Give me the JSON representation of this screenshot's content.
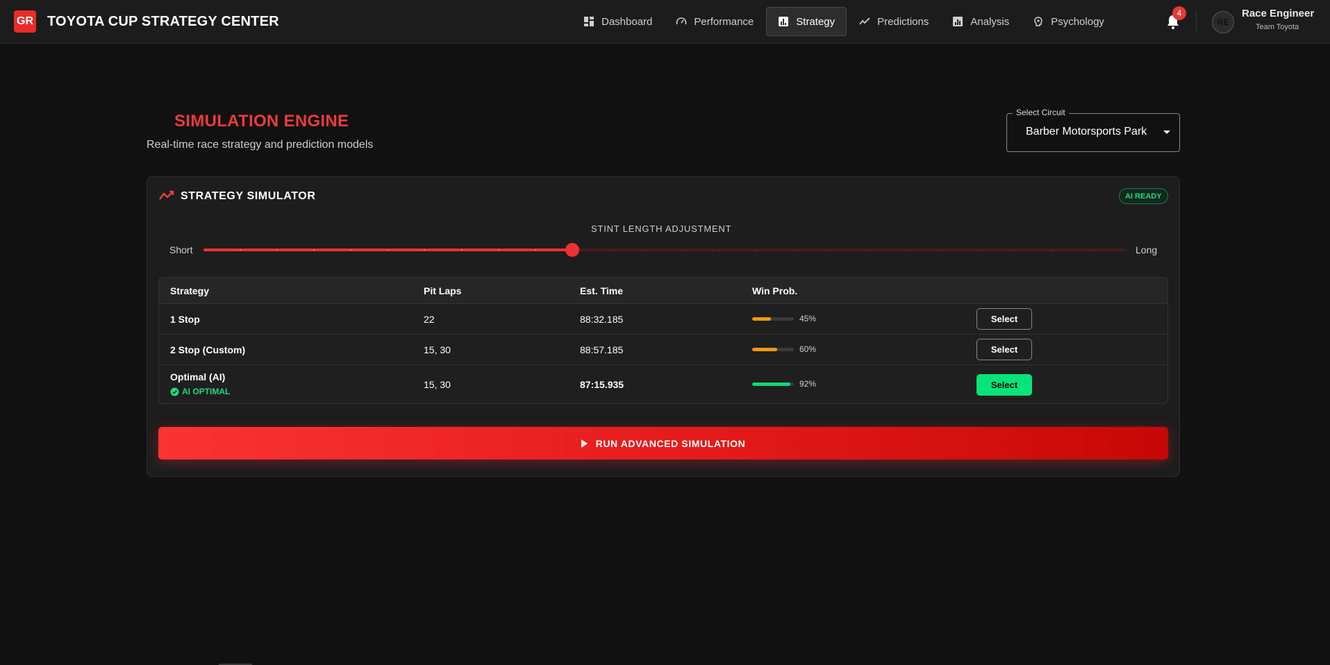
{
  "header": {
    "logo_text": "GR",
    "app_title": "TOYOTA CUP STRATEGY CENTER",
    "nav": [
      {
        "label": "Dashboard",
        "icon": "dashboard-icon",
        "active": false
      },
      {
        "label": "Performance",
        "icon": "speedometer-icon",
        "active": false
      },
      {
        "label": "Strategy",
        "icon": "bar-chart-icon",
        "active": true
      },
      {
        "label": "Predictions",
        "icon": "trend-line-icon",
        "active": false
      },
      {
        "label": "Analysis",
        "icon": "analytics-icon",
        "active": false
      },
      {
        "label": "Psychology",
        "icon": "brain-icon",
        "active": false
      }
    ],
    "notifications_count": "4",
    "user": {
      "initials": "RE",
      "name": "Race Engineer",
      "team": "Team Toyota"
    }
  },
  "page": {
    "title": "SIMULATION ENGINE",
    "subtitle": "Real-time race strategy and prediction models",
    "circuit_select": {
      "label": "Select Circuit",
      "value": "Barber Motorsports Park"
    }
  },
  "simulator": {
    "title": "STRATEGY SIMULATOR",
    "badge": "AI READY",
    "slider": {
      "label": "STINT LENGTH ADJUSTMENT",
      "min_label": "Short",
      "max_label": "Long",
      "steps": 25,
      "value_fraction": 0.4
    },
    "table": {
      "columns": [
        "Strategy",
        "Pit Laps",
        "Est. Time",
        "Win Prob."
      ],
      "rows": [
        {
          "strategy": "1 Stop",
          "pit_laps": "22",
          "est_time": "88:32.185",
          "win_prob": 45,
          "win_prob_text": "45%",
          "bar_color": "#f59a0c",
          "tag": "",
          "button": "Select",
          "highlight": false
        },
        {
          "strategy": "2 Stop (Custom)",
          "pit_laps": "15, 30",
          "est_time": "88:57.185",
          "win_prob": 60,
          "win_prob_text": "60%",
          "bar_color": "#f59a0c",
          "tag": "",
          "button": "Select",
          "highlight": false
        },
        {
          "strategy": "Optimal (AI)",
          "pit_laps": "15, 30",
          "est_time": "87:15.935",
          "win_prob": 92,
          "win_prob_text": "92%",
          "bar_color": "#12d878",
          "tag": "AI OPTIMAL",
          "button": "Select",
          "highlight": true
        }
      ]
    },
    "run_button": "RUN ADVANCED SIMULATION"
  },
  "colors": {
    "accent_red": "#ee3a3a",
    "success_green": "#08e47a",
    "warning_orange": "#f59a0c",
    "background": "#111111"
  }
}
